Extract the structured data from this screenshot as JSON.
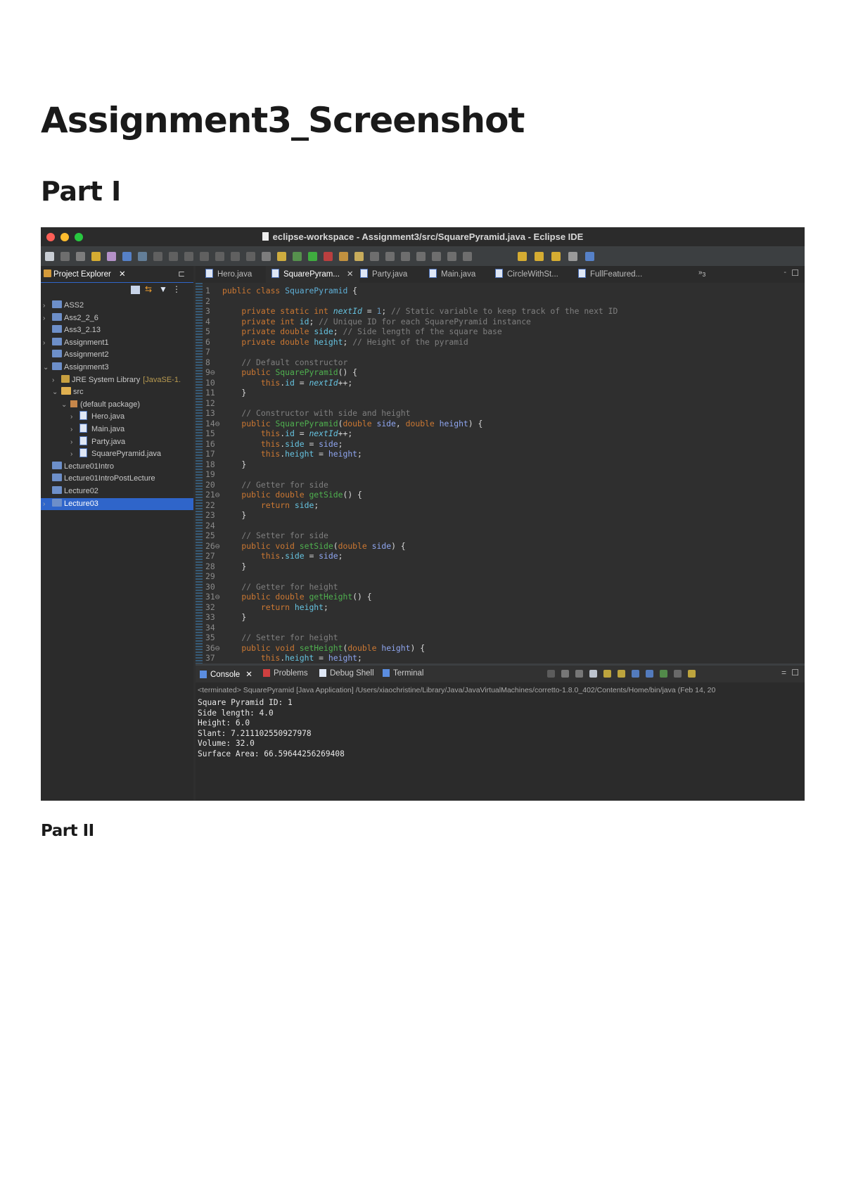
{
  "document": {
    "title": "Assignment3_Screenshot",
    "part1": "Part I",
    "part2": "Part II"
  },
  "ide": {
    "window_title": "eclipse-workspace - Assignment3/src/SquarePyramid.java - Eclipse IDE",
    "colors": {
      "close": "#fe5f57",
      "minimize": "#febc2e",
      "maximize": "#28c840",
      "selection": "#2f65ca",
      "background": "#2f2f2f"
    },
    "explorer": {
      "title": "Project Explorer",
      "items": [
        {
          "label": "ASS2",
          "expanded": false,
          "depth": 0
        },
        {
          "label": "Ass2_2_6",
          "expanded": false,
          "depth": 0
        },
        {
          "label": "Ass3_2.13",
          "depth": 0
        },
        {
          "label": "Assignment1",
          "expanded": false,
          "depth": 0
        },
        {
          "label": "Assignment2",
          "depth": 0
        },
        {
          "label": "Assignment3",
          "expanded": true,
          "depth": 0
        },
        {
          "label": "JRE System Library",
          "suffix": "[JavaSE-1.",
          "expanded": false,
          "depth": 1
        },
        {
          "label": "src",
          "expanded": true,
          "depth": 1
        },
        {
          "label": "(default package)",
          "expanded": true,
          "depth": 2
        },
        {
          "label": "Hero.java",
          "expanded": false,
          "depth": 3
        },
        {
          "label": "Main.java",
          "expanded": false,
          "depth": 3
        },
        {
          "label": "Party.java",
          "expanded": false,
          "depth": 3
        },
        {
          "label": "SquarePyramid.java",
          "expanded": false,
          "depth": 3
        },
        {
          "label": "Lecture01Intro",
          "depth": 0
        },
        {
          "label": "Lecture01IntroPostLecture",
          "depth": 0
        },
        {
          "label": "Lecture02",
          "depth": 0
        },
        {
          "label": "Lecture03",
          "expanded": false,
          "depth": 0,
          "selected": true
        }
      ]
    },
    "editor_tabs": [
      {
        "label": "Hero.java"
      },
      {
        "label": "SquarePyram...",
        "active": true
      },
      {
        "label": "Party.java"
      },
      {
        "label": "Main.java"
      },
      {
        "label": "CircleWithSt..."
      },
      {
        "label": "FullFeatured..."
      }
    ],
    "overflow_tabs": "3",
    "code": [
      [
        [
          "public class ",
          "kw"
        ],
        [
          "SquarePyramid",
          "typ"
        ],
        [
          " {",
          ""
        ]
      ],
      [],
      [
        [
          "    private static int ",
          "kw"
        ],
        [
          "nextId",
          "fld ital"
        ],
        [
          " = ",
          ""
        ],
        [
          "1",
          "num"
        ],
        [
          "; ",
          ""
        ],
        [
          "// Static variable to keep track of the next ID",
          "cm"
        ]
      ],
      [
        [
          "    private int ",
          "kw"
        ],
        [
          "id",
          "fld"
        ],
        [
          "; ",
          ""
        ],
        [
          "// Unique ID for each SquarePyramid instance",
          "cm"
        ]
      ],
      [
        [
          "    private double ",
          "kw"
        ],
        [
          "side",
          "fld"
        ],
        [
          "; ",
          ""
        ],
        [
          "// Side length of the square base",
          "cm"
        ]
      ],
      [
        [
          "    private double ",
          "kw"
        ],
        [
          "height",
          "fld"
        ],
        [
          "; ",
          ""
        ],
        [
          "// Height of the pyramid",
          "cm"
        ]
      ],
      [],
      [
        [
          "    // Default constructor",
          "cm"
        ]
      ],
      [
        [
          "    public ",
          "kw"
        ],
        [
          "SquarePyramid",
          "mth"
        ],
        [
          "() {",
          ""
        ]
      ],
      [
        [
          "        this",
          "kw"
        ],
        [
          ".",
          ""
        ],
        [
          "id",
          "fld"
        ],
        [
          " = ",
          ""
        ],
        [
          "nextId",
          "fld ital"
        ],
        [
          "++;",
          ""
        ]
      ],
      [
        [
          "    }",
          ""
        ]
      ],
      [],
      [
        [
          "    // Constructor with side and height",
          "cm"
        ]
      ],
      [
        [
          "    public ",
          "kw"
        ],
        [
          "SquarePyramid",
          "mth"
        ],
        [
          "(",
          ""
        ],
        [
          "double ",
          "kw"
        ],
        [
          "side",
          "par"
        ],
        [
          ", ",
          ""
        ],
        [
          "double ",
          "kw"
        ],
        [
          "height",
          "par"
        ],
        [
          ") {",
          ""
        ]
      ],
      [
        [
          "        this",
          "kw"
        ],
        [
          ".",
          ""
        ],
        [
          "id",
          "fld"
        ],
        [
          " = ",
          ""
        ],
        [
          "nextId",
          "fld ital"
        ],
        [
          "++;",
          ""
        ]
      ],
      [
        [
          "        this",
          "kw"
        ],
        [
          ".",
          ""
        ],
        [
          "side",
          "fld"
        ],
        [
          " = ",
          ""
        ],
        [
          "side",
          "par"
        ],
        [
          ";",
          ""
        ]
      ],
      [
        [
          "        this",
          "kw"
        ],
        [
          ".",
          ""
        ],
        [
          "height",
          "fld"
        ],
        [
          " = ",
          ""
        ],
        [
          "height",
          "par"
        ],
        [
          ";",
          ""
        ]
      ],
      [
        [
          "    }",
          ""
        ]
      ],
      [],
      [
        [
          "    // Getter for side",
          "cm"
        ]
      ],
      [
        [
          "    public double ",
          "kw"
        ],
        [
          "getSide",
          "mth"
        ],
        [
          "() {",
          ""
        ]
      ],
      [
        [
          "        return ",
          "kw"
        ],
        [
          "side",
          "fld"
        ],
        [
          ";",
          ""
        ]
      ],
      [
        [
          "    }",
          ""
        ]
      ],
      [],
      [
        [
          "    // Setter for side",
          "cm"
        ]
      ],
      [
        [
          "    public void ",
          "kw"
        ],
        [
          "setSide",
          "mth"
        ],
        [
          "(",
          ""
        ],
        [
          "double ",
          "kw"
        ],
        [
          "side",
          "par"
        ],
        [
          ") {",
          ""
        ]
      ],
      [
        [
          "        this",
          "kw"
        ],
        [
          ".",
          ""
        ],
        [
          "side",
          "fld"
        ],
        [
          " = ",
          ""
        ],
        [
          "side",
          "par"
        ],
        [
          ";",
          ""
        ]
      ],
      [
        [
          "    }",
          ""
        ]
      ],
      [],
      [
        [
          "    // Getter for height",
          "cm"
        ]
      ],
      [
        [
          "    public double ",
          "kw"
        ],
        [
          "getHeight",
          "mth"
        ],
        [
          "() {",
          ""
        ]
      ],
      [
        [
          "        return ",
          "kw"
        ],
        [
          "height",
          "fld"
        ],
        [
          ";",
          ""
        ]
      ],
      [
        [
          "    }",
          ""
        ]
      ],
      [],
      [
        [
          "    // Setter for height",
          "cm"
        ]
      ],
      [
        [
          "    public void ",
          "kw"
        ],
        [
          "setHeight",
          "mth"
        ],
        [
          "(",
          ""
        ],
        [
          "double ",
          "kw"
        ],
        [
          "height",
          "par"
        ],
        [
          ") {",
          ""
        ]
      ],
      [
        [
          "        this",
          "kw"
        ],
        [
          ".",
          ""
        ],
        [
          "height",
          "fld"
        ],
        [
          " = ",
          ""
        ],
        [
          "height",
          "par"
        ],
        [
          ";",
          ""
        ]
      ]
    ],
    "fold_lines": [
      9,
      14,
      21,
      26,
      31,
      36
    ],
    "console": {
      "tabs": [
        {
          "label": "Console",
          "active": true
        },
        {
          "label": "Problems"
        },
        {
          "label": "Debug Shell"
        },
        {
          "label": "Terminal"
        }
      ],
      "status": "<terminated> SquarePyramid [Java Application] /Users/xiaochristine/Library/Java/JavaVirtualMachines/corretto-1.8.0_402/Contents/Home/bin/java  (Feb 14, 20",
      "output": [
        "Square Pyramid ID: 1",
        "Side length: 4.0",
        "Height: 6.0",
        "Slant: 7.211102550927978",
        "Volume: 32.0",
        "Surface Area: 66.59644256269408"
      ]
    }
  }
}
